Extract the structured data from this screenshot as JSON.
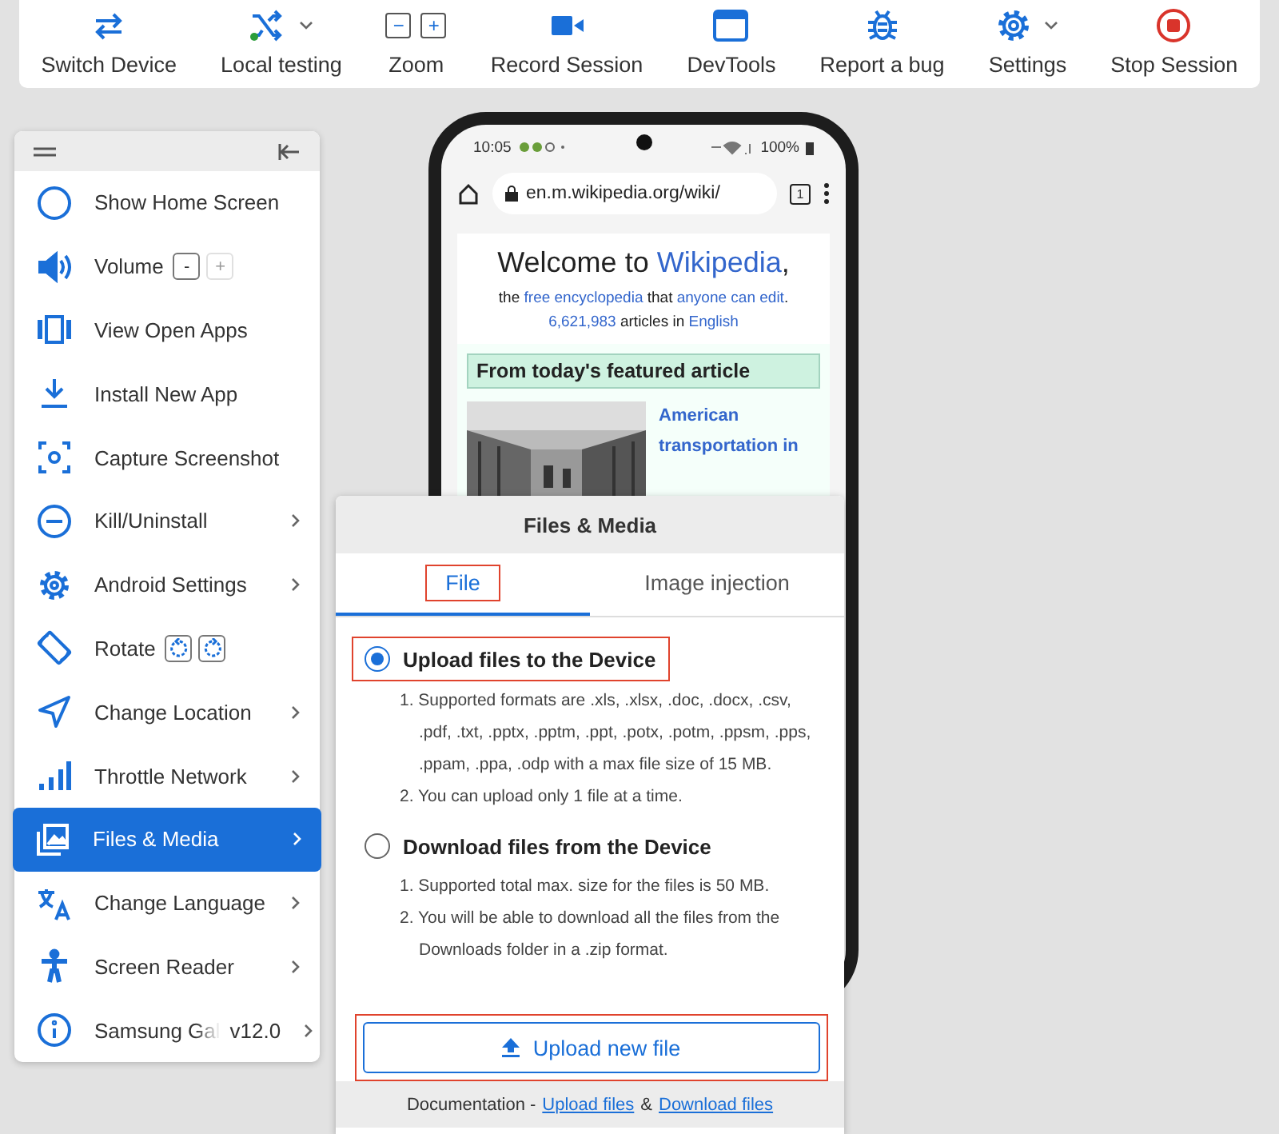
{
  "toolbar": [
    {
      "label": "Switch Device",
      "kind": "swap",
      "dropdown": false
    },
    {
      "label": "Local testing",
      "kind": "shuffle",
      "dropdown": true
    },
    {
      "label": "Zoom",
      "kind": "zoom",
      "buttons": [
        "−",
        "+"
      ],
      "dropdown": false
    },
    {
      "label": "Record Session",
      "kind": "video",
      "dropdown": false
    },
    {
      "label": "DevTools",
      "kind": "window",
      "dropdown": false
    },
    {
      "label": "Report a bug",
      "kind": "bug",
      "dropdown": false
    },
    {
      "label": "Settings",
      "kind": "gear",
      "dropdown": true
    },
    {
      "label": "Stop Session",
      "kind": "stop",
      "dropdown": false
    }
  ],
  "menu": {
    "items": [
      {
        "label": "Show Home Screen",
        "kind": "home",
        "submenu": false,
        "selected": false
      },
      {
        "label": "Volume",
        "kind": "volume",
        "submenu": false,
        "selected": false,
        "buttons": [
          {
            "kind": "text",
            "label": "-",
            "disabled": false
          },
          {
            "kind": "text",
            "label": "+",
            "disabled": true
          }
        ]
      },
      {
        "label": "View Open Apps",
        "kind": "apps",
        "submenu": false,
        "selected": false
      },
      {
        "label": "Install New App",
        "kind": "install",
        "submenu": false,
        "selected": false
      },
      {
        "label": "Capture Screenshot",
        "kind": "screenshot",
        "submenu": false,
        "selected": false
      },
      {
        "label": "Kill/Uninstall",
        "kind": "kill",
        "submenu": true,
        "selected": false
      },
      {
        "label": "Android Settings",
        "kind": "settings",
        "submenu": true,
        "selected": false
      },
      {
        "label": "Rotate",
        "kind": "rotate",
        "submenu": false,
        "selected": false,
        "buttons": [
          {
            "kind": "rotate-left",
            "disabled": false
          },
          {
            "kind": "rotate-right",
            "disabled": false
          }
        ]
      },
      {
        "label": "Change Location",
        "kind": "location",
        "submenu": true,
        "selected": false
      },
      {
        "label": "Throttle Network",
        "kind": "network",
        "submenu": true,
        "selected": false
      },
      {
        "label": "Files & Media",
        "kind": "media",
        "submenu": true,
        "selected": true
      },
      {
        "label": "Change Language",
        "kind": "language",
        "submenu": true,
        "selected": false
      },
      {
        "label": "Screen Reader",
        "kind": "reader",
        "submenu": true,
        "selected": false
      },
      {
        "label": "Samsung Gal",
        "kind": "info",
        "submenu": true,
        "selected": false,
        "value": "v12.0"
      }
    ]
  },
  "phone": {
    "time": "10:05",
    "battery": "100%",
    "url": "en.m.wikipedia.org/wiki/",
    "tab_count": "1",
    "heading": [
      {
        "text": "Welcome to ",
        "link": false
      },
      {
        "text": "Wikipedia",
        "link": true
      },
      {
        "text": ",",
        "link": false
      }
    ],
    "intro": [
      {
        "text": "the ",
        "link": false
      },
      {
        "text": "free encyclopedia",
        "link": true
      },
      {
        "text": " that ",
        "link": false
      },
      {
        "text": "anyone can edit",
        "link": true
      },
      {
        "text": ".",
        "link": false
      }
    ],
    "stats": [
      {
        "text": "6,621,983",
        "link": true
      },
      {
        "text": " articles in ",
        "link": false
      },
      {
        "text": "English",
        "link": true
      }
    ],
    "featured_title": "From today's featured article",
    "featured_link": "American transportation in"
  },
  "files_panel": {
    "title": "Files & Media",
    "tabs": [
      {
        "label": "File",
        "selected": true,
        "highlighted": true
      },
      {
        "label": "Image injection",
        "selected": false,
        "highlighted": false
      }
    ],
    "options": [
      {
        "label": "Upload files to the Device",
        "selected": true,
        "highlighted": true,
        "notes": [
          "1. Supported formats are .xls, .xlsx, .doc, .docx, .csv, .pdf, .txt, .pptx, .pptm, .ppt, .potx, .potm, .ppsm, .pps, .ppam, .ppa, .odp with a max file size of 15 MB.",
          "2. You can upload only 1 file at a time."
        ]
      },
      {
        "label": "Download files from the Device",
        "selected": false,
        "highlighted": false,
        "notes": [
          "1. Supported total max. size for the files is 50 MB.",
          "2. You will be able to download all the files from the Downloads folder in a .zip format."
        ]
      }
    ],
    "button": {
      "label": "Upload new file",
      "highlighted": true
    },
    "footer": {
      "text": "Documentation -",
      "links": [
        "Upload files",
        "Download files"
      ],
      "separator": "&"
    }
  }
}
